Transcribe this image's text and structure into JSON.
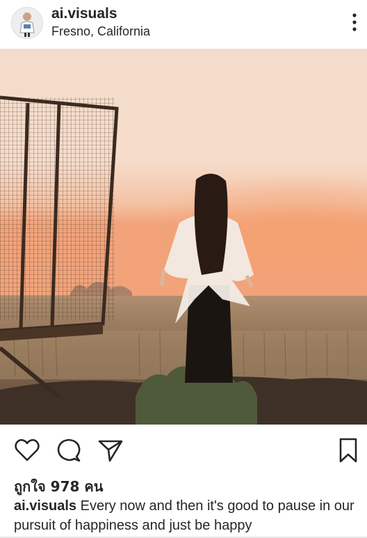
{
  "post": {
    "username": "ai.visuals",
    "location": "Fresno, California",
    "likes_text": "ถูกใจ 978 คน",
    "caption_username": "ai.visuals",
    "caption_text": " Every now and then it's good to pause in our pursuit of happiness and just be happy"
  },
  "icons": {
    "more": "more-vertical-icon",
    "like": "heart-icon",
    "comment": "comment-bubble-icon",
    "share": "paper-plane-icon",
    "save": "bookmark-icon"
  },
  "colors": {
    "text": "#262626",
    "sky_top": "#f3dcc9",
    "sky_glow": "#f4a474",
    "field": "#7a6248"
  }
}
